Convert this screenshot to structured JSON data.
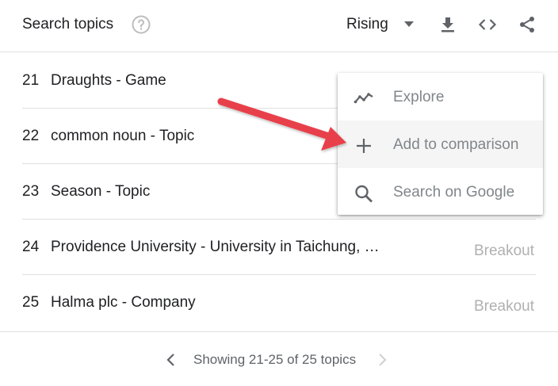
{
  "header": {
    "title": "Search topics",
    "help_icon": "help-circle-icon",
    "sort_selected": "Rising",
    "tools": [
      "download-icon",
      "embed-code-icon",
      "share-icon"
    ]
  },
  "rows": [
    {
      "rank": "21",
      "label": "Draughts - Game",
      "value": ""
    },
    {
      "rank": "22",
      "label": "common noun - Topic",
      "value": ""
    },
    {
      "rank": "23",
      "label": "Season - Topic",
      "value": ""
    },
    {
      "rank": "24",
      "label": "Providence University - University in Taichung, …",
      "value": "Breakout"
    },
    {
      "rank": "25",
      "label": "Halma plc - Company",
      "value": "Breakout"
    }
  ],
  "menu": {
    "items": [
      {
        "label": "Explore",
        "icon": "trend-line-icon"
      },
      {
        "label": "Add to comparison",
        "icon": "plus-icon"
      },
      {
        "label": "Search on Google",
        "icon": "search-icon"
      }
    ]
  },
  "footer": {
    "text": "Showing 21-25 of 25 topics"
  },
  "colors": {
    "annotation_arrow": "#e8404b",
    "muted_text": "#b0b0b0",
    "divider": "#e0e0e0"
  }
}
